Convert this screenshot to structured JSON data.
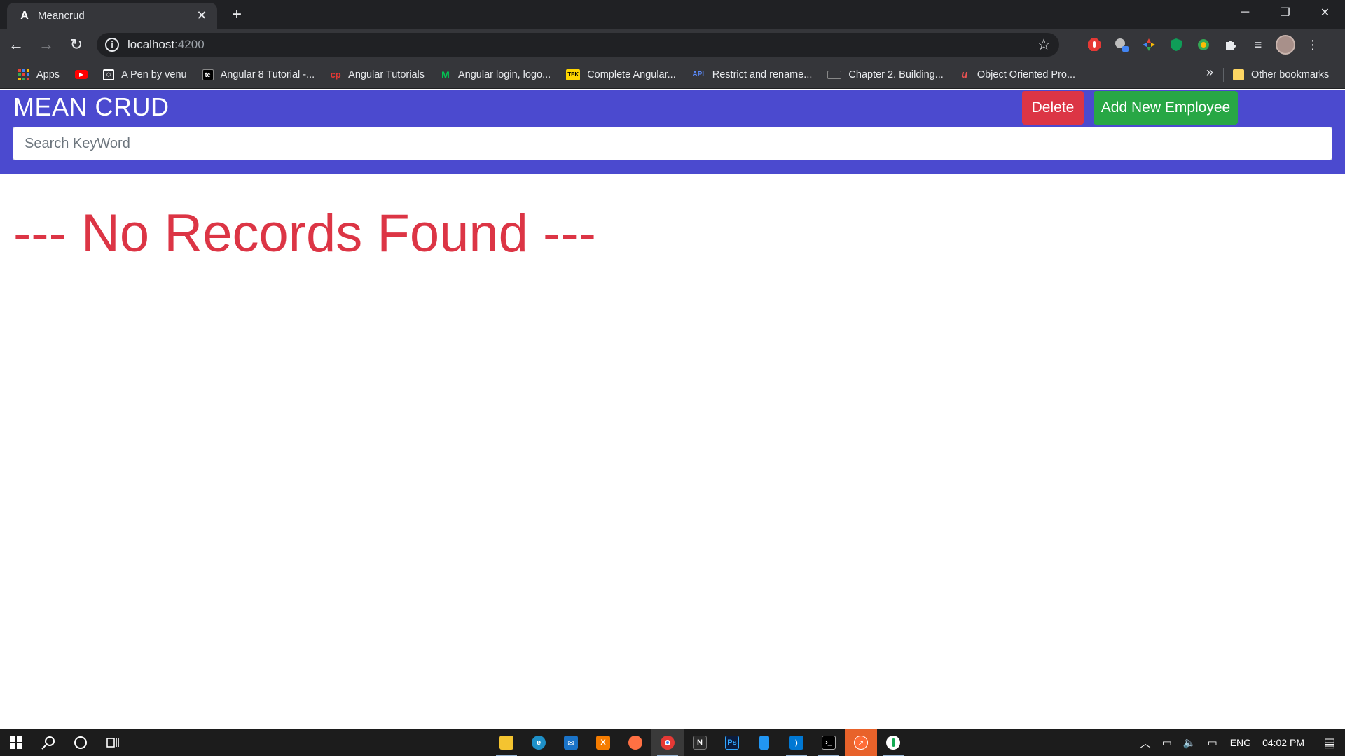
{
  "browser": {
    "tab": {
      "title": "Meancrud",
      "favicon": "angular-icon"
    },
    "new_tab_label": "+",
    "window_controls": {
      "minimize": "─",
      "restore": "❐",
      "close": "✕"
    },
    "address": {
      "host": "localhost",
      "port": ":4200"
    },
    "bookmarks": [
      {
        "label": "Apps",
        "icon": "apps-grid-icon",
        "color": "#4285f4"
      },
      {
        "label": "",
        "icon": "youtube-icon",
        "color": "#ff0000"
      },
      {
        "label": "A Pen by venu",
        "icon": "codepen-icon",
        "color": "#ffffff"
      },
      {
        "label": "Angular 8 Tutorial -...",
        "icon": "tutorial-icon",
        "color": "#000000"
      },
      {
        "label": "Angular Tutorials",
        "icon": "cp-icon",
        "color": "#e53935"
      },
      {
        "label": "Angular login, logo...",
        "icon": "m-icon",
        "color": "#00c853"
      },
      {
        "label": "Complete Angular...",
        "icon": "tek-icon",
        "color": "#ffd600"
      },
      {
        "label": "Restrict and rename...",
        "icon": "api-icon",
        "color": "#2979ff"
      },
      {
        "label": "Chapter 2. Building...",
        "icon": "book-icon",
        "color": "#616161"
      },
      {
        "label": "Object Oriented Pro...",
        "icon": "udemy-icon",
        "color": "#ec5252"
      }
    ],
    "bookmarks_overflow": "»",
    "other_bookmarks": "Other bookmarks"
  },
  "app": {
    "title": "MEAN CRUD",
    "delete_label": "Delete",
    "add_label": "Add New Employee",
    "search_placeholder": "Search KeyWord",
    "empty_message": "--- No Records Found ---",
    "colors": {
      "header": "#4b4acf",
      "delete": "#dc3545",
      "add": "#28a745",
      "empty_text": "#dc3545"
    }
  },
  "taskbar": {
    "language": "ENG",
    "time": "04:02 PM",
    "apps": [
      "file-explorer-icon",
      "edge-icon",
      "mail-icon",
      "xampp-icon",
      "firefox-icon",
      "chrome-icon",
      "notion-icon",
      "photoshop-icon",
      "notepad-icon",
      "vscode-icon",
      "terminal-icon",
      "postman-icon",
      "mongodb-icon"
    ]
  }
}
